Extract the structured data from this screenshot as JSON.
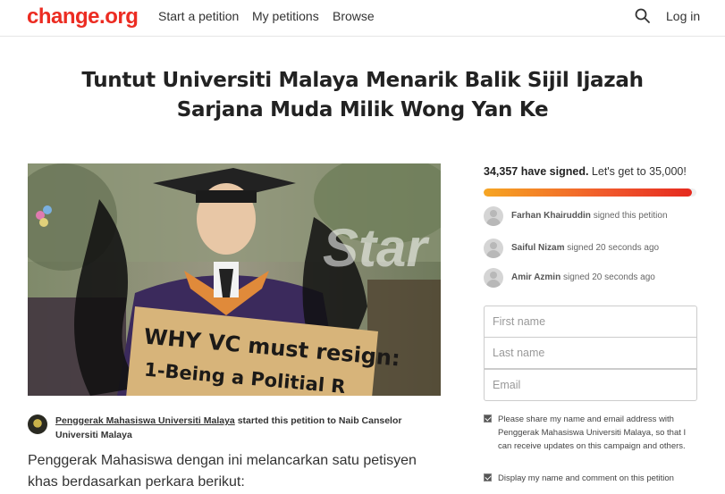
{
  "header": {
    "logo": "change.org",
    "nav": [
      "Start a petition",
      "My petitions",
      "Browse"
    ],
    "login": "Log in"
  },
  "petition": {
    "title": "Tuntut Universiti Malaya Menarik Balik Sijil Ijazah Sarjana Muda Milik Wong Yan Ke",
    "photo": {
      "sign_line1": "WHY VC must resign:",
      "sign_line2": "1-Being a Politial R",
      "watermark": "Star"
    },
    "starter": {
      "name": "Penggerak Mahasiswa Universiti Malaya",
      "action": "started this petition to",
      "target": "Naib Canselor Universiti Malaya"
    },
    "body": "Penggerak Mahasiswa dengan ini melancarkan satu petisyen khas berdasarkan perkara berikut:"
  },
  "sidebar": {
    "signed_count": "34,357 have signed.",
    "goal_text": "Let's get to 35,000!",
    "progress_fraction": 0.98,
    "recent_signers": [
      {
        "name": "Farhan Khairuddin",
        "action": "signed this petition"
      },
      {
        "name": "Saiful Nizam",
        "action": "signed 20 seconds ago"
      },
      {
        "name": "Amir Azmin",
        "action": "signed 20 seconds ago"
      }
    ],
    "form": {
      "first_name_placeholder": "First name",
      "last_name_placeholder": "Last name",
      "email_placeholder": "Email"
    },
    "checkbox_share": "Please share my name and email address with Penggerak Mahasiswa Universiti Malaya, so that I can receive updates on this campaign and others.",
    "checkbox_display": "Display my name and comment on this petition"
  },
  "colors": {
    "brand": "#ec2c22",
    "progress_start": "#f6a623",
    "progress_end": "#e52a1f"
  }
}
